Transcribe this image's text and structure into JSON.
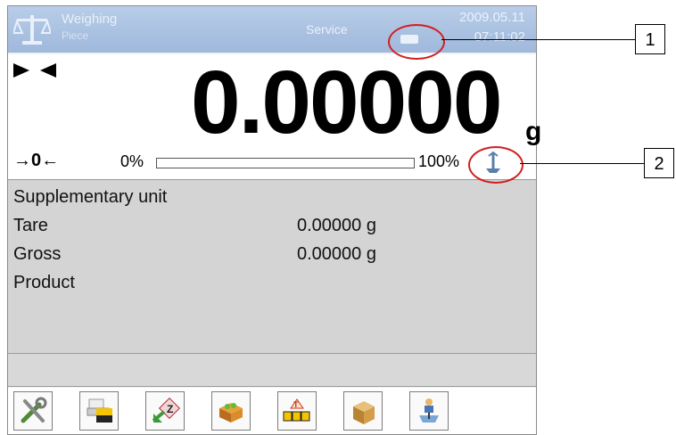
{
  "header": {
    "title": "Weighing",
    "subtitle": "Piece",
    "mode": "Service",
    "date": "2009.05.11",
    "time": "07:11:02"
  },
  "display": {
    "reading": "0.00000",
    "unit": "g",
    "zero_indicator": "→0←",
    "range_start": "0%",
    "range_end": "100%",
    "load_fraction": 0,
    "stable_icon": "stability-marker-icon",
    "level_icon": "level-indicator-icon"
  },
  "info": {
    "rows": [
      {
        "label": "Supplementary unit",
        "value": ""
      },
      {
        "label": "Tare",
        "value": "0.00000 g"
      },
      {
        "label": "Gross",
        "value": "0.00000 g"
      },
      {
        "label": "Product",
        "value": ""
      }
    ]
  },
  "toolbar": {
    "buttons": [
      {
        "icon": "tools-settings-icon"
      },
      {
        "icon": "printer-icon"
      },
      {
        "icon": "zero-icon"
      },
      {
        "icon": "products-database-icon"
      },
      {
        "icon": "tare-icon"
      },
      {
        "icon": "packaging-icon"
      },
      {
        "icon": "level-adjust-icon"
      }
    ]
  },
  "callouts": [
    "1",
    "2"
  ],
  "colors": {
    "header_bg": "#a9c0e1",
    "callout_red": "#d21f1f"
  }
}
